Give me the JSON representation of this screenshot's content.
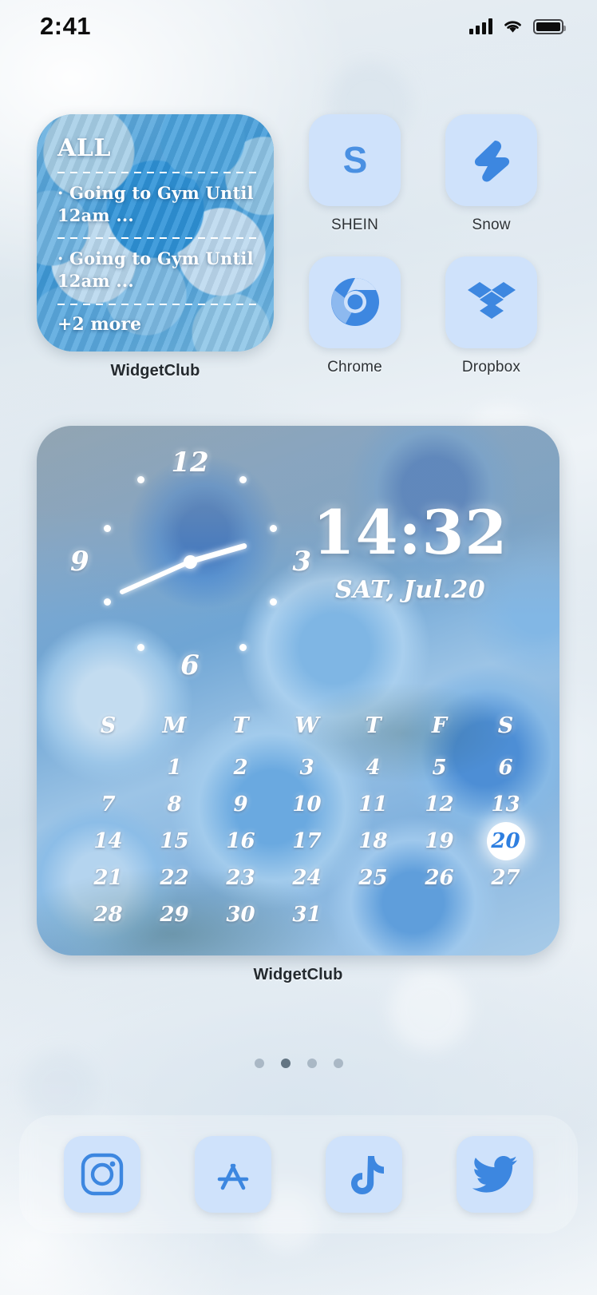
{
  "status_bar": {
    "time": "2:41",
    "signal_icon": "cellular-bars-icon",
    "wifi_icon": "wifi-icon",
    "battery_icon": "battery-full-icon"
  },
  "reminder_widget": {
    "title": "ALL",
    "items": [
      "· Going to Gym Until 12am ...",
      "· Going to Gym Until 12am ..."
    ],
    "more": "+2 more",
    "label": "WidgetClub"
  },
  "apps": [
    {
      "name": "SHEIN",
      "icon": "shein-letter-s-icon"
    },
    {
      "name": "Snow",
      "icon": "snow-lightning-bolt-icon"
    },
    {
      "name": "Chrome",
      "icon": "chrome-icon"
    },
    {
      "name": "Dropbox",
      "icon": "dropbox-icon"
    }
  ],
  "clock_widget": {
    "label": "WidgetClub",
    "analog": {
      "numerals": [
        "12",
        "3",
        "6",
        "9"
      ],
      "hour_angle": 74,
      "minute_angle": -114
    },
    "digital_time": "14:32",
    "digital_date": "SAT, Jul.20",
    "calendar": {
      "weekdays": [
        "S",
        "M",
        "T",
        "W",
        "T",
        "F",
        "S"
      ],
      "weeks": [
        [
          "",
          "1",
          "2",
          "3",
          "4",
          "5",
          "6"
        ],
        [
          "7",
          "8",
          "9",
          "10",
          "11",
          "12",
          "13"
        ],
        [
          "14",
          "15",
          "16",
          "17",
          "18",
          "19",
          "20"
        ],
        [
          "21",
          "22",
          "23",
          "24",
          "25",
          "26",
          "27"
        ],
        [
          "28",
          "29",
          "30",
          "31",
          "",
          "",
          ""
        ]
      ],
      "today": "20"
    }
  },
  "page_dots": {
    "count": 4,
    "active_index": 1
  },
  "dock": [
    {
      "name": "Instagram",
      "icon": "instagram-icon"
    },
    {
      "name": "App Store",
      "icon": "app-store-icon"
    },
    {
      "name": "TikTok",
      "icon": "tiktok-icon"
    },
    {
      "name": "Twitter",
      "icon": "twitter-bird-icon"
    }
  ],
  "colors": {
    "tile_bg": "#cfe2fb",
    "icon_blue": "#4a90e2",
    "today_blue": "#2f7fe0"
  }
}
